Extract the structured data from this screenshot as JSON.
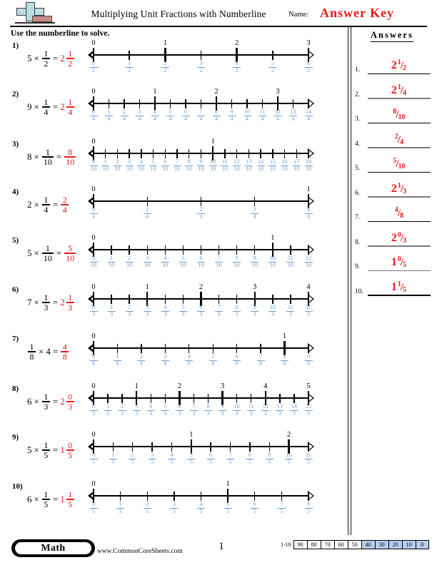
{
  "header": {
    "title": "Multiplying Unit Fractions with Numberline",
    "name_label": "Name:",
    "answer_key": "Answer Key",
    "logo_name": "commoncoresheets-logo"
  },
  "instructions": "Use the numberline to solve.",
  "answers_panel": {
    "heading": "Answers",
    "items": [
      {
        "num": "1.",
        "whole": "2",
        "numerator": "1",
        "denominator": "2",
        "rule_color": "#000000"
      },
      {
        "num": "2.",
        "whole": "2",
        "numerator": "1",
        "denominator": "4",
        "rule_color": "#7a7a7a"
      },
      {
        "num": "3.",
        "whole": "",
        "numerator": "8",
        "denominator": "10",
        "rule_color": "#000000"
      },
      {
        "num": "4.",
        "whole": "",
        "numerator": "2",
        "denominator": "4",
        "rule_color": "#7a7a7a"
      },
      {
        "num": "5.",
        "whole": "",
        "numerator": "5",
        "denominator": "10",
        "rule_color": "#000000"
      },
      {
        "num": "6.",
        "whole": "2",
        "numerator": "1",
        "denominator": "3",
        "rule_color": "#7a7a7a"
      },
      {
        "num": "7.",
        "whole": "",
        "numerator": "4",
        "denominator": "8",
        "rule_color": "#000000"
      },
      {
        "num": "8.",
        "whole": "2",
        "numerator": "0",
        "denominator": "3",
        "rule_color": "#7a7a7a"
      },
      {
        "num": "9.",
        "whole": "1",
        "numerator": "0",
        "denominator": "5",
        "rule_color": "#7a7a7a"
      },
      {
        "num": "10.",
        "whole": "1",
        "numerator": "1",
        "denominator": "5",
        "rule_color": "#000000"
      }
    ]
  },
  "problems": [
    {
      "num": "1)",
      "expr": {
        "a": "5",
        "op": "×",
        "frac_num": "1",
        "frac_den": "2",
        "eq": "=",
        "ans_whole": "2",
        "ans_num": "1",
        "ans_den": "2",
        "reversed": false
      },
      "numberline": {
        "denominator": 2,
        "max_numerator": 6,
        "wholes": [
          "0",
          "1",
          "2",
          "3"
        ]
      }
    },
    {
      "num": "2)",
      "expr": {
        "a": "9",
        "op": "×",
        "frac_num": "1",
        "frac_den": "4",
        "eq": "=",
        "ans_whole": "2",
        "ans_num": "1",
        "ans_den": "4",
        "reversed": false
      },
      "numberline": {
        "denominator": 4,
        "max_numerator": 14,
        "wholes": [
          "0",
          "1",
          "2",
          "3"
        ]
      }
    },
    {
      "num": "3)",
      "expr": {
        "a": "8",
        "op": "×",
        "frac_num": "1",
        "frac_den": "10",
        "eq": "=",
        "ans_whole": "",
        "ans_num": "8",
        "ans_den": "10",
        "reversed": false
      },
      "numberline": {
        "denominator": 10,
        "max_numerator": 18,
        "wholes": [
          "0",
          "1"
        ]
      }
    },
    {
      "num": "4)",
      "expr": {
        "a": "2",
        "op": "×",
        "frac_num": "1",
        "frac_den": "4",
        "eq": "=",
        "ans_whole": "",
        "ans_num": "2",
        "ans_den": "4",
        "reversed": false
      },
      "numberline": {
        "denominator": 4,
        "max_numerator": 4,
        "wholes": [
          "0",
          "1"
        ]
      }
    },
    {
      "num": "5)",
      "expr": {
        "a": "5",
        "op": "×",
        "frac_num": "1",
        "frac_den": "10",
        "eq": "=",
        "ans_whole": "",
        "ans_num": "5",
        "ans_den": "10",
        "reversed": false
      },
      "numberline": {
        "denominator": 10,
        "max_numerator": 12,
        "wholes": [
          "0",
          "1"
        ]
      }
    },
    {
      "num": "6)",
      "expr": {
        "a": "7",
        "op": "×",
        "frac_num": "1",
        "frac_den": "3",
        "eq": "=",
        "ans_whole": "2",
        "ans_num": "1",
        "ans_den": "3",
        "reversed": false
      },
      "numberline": {
        "denominator": 3,
        "max_numerator": 12,
        "wholes": [
          "0",
          "1",
          "2",
          "3",
          "4"
        ]
      }
    },
    {
      "num": "7)",
      "expr": {
        "a": "4",
        "op": "×",
        "frac_num": "1",
        "frac_den": "8",
        "eq": "=",
        "ans_whole": "",
        "ans_num": "4",
        "ans_den": "8",
        "reversed": true
      },
      "numberline": {
        "denominator": 8,
        "max_numerator": 9,
        "wholes": [
          "0",
          "1"
        ]
      }
    },
    {
      "num": "8)",
      "expr": {
        "a": "6",
        "op": "×",
        "frac_num": "1",
        "frac_den": "3",
        "eq": "=",
        "ans_whole": "2",
        "ans_num": "0",
        "ans_den": "3",
        "reversed": false
      },
      "numberline": {
        "denominator": 3,
        "max_numerator": 15,
        "wholes": [
          "0",
          "1",
          "2",
          "3",
          "4",
          "5"
        ]
      }
    },
    {
      "num": "9)",
      "expr": {
        "a": "5",
        "op": "×",
        "frac_num": "1",
        "frac_den": "5",
        "eq": "=",
        "ans_whole": "1",
        "ans_num": "0",
        "ans_den": "5",
        "reversed": false
      },
      "numberline": {
        "denominator": 5,
        "max_numerator": 11,
        "wholes": [
          "0",
          "1",
          "2"
        ]
      }
    },
    {
      "num": "10)",
      "expr": {
        "a": "6",
        "op": "×",
        "frac_num": "1",
        "frac_den": "5",
        "eq": "=",
        "ans_whole": "1",
        "ans_num": "1",
        "ans_den": "5",
        "reversed": false
      },
      "numberline": {
        "denominator": 5,
        "max_numerator": 8,
        "wholes": [
          "0",
          "1"
        ]
      }
    }
  ],
  "footer": {
    "subject": "Math",
    "url": "www.CommonCoreSheets.com",
    "page": "1",
    "score_range": "1-10",
    "score_cells": [
      {
        "label": "90",
        "highlighted": false
      },
      {
        "label": "80",
        "highlighted": false
      },
      {
        "label": "70",
        "highlighted": false
      },
      {
        "label": "60",
        "highlighted": false
      },
      {
        "label": "50",
        "highlighted": false
      },
      {
        "label": "40",
        "highlighted": true
      },
      {
        "label": "30",
        "highlighted": true
      },
      {
        "label": "20",
        "highlighted": true
      },
      {
        "label": "10",
        "highlighted": true
      },
      {
        "label": "0",
        "highlighted": true
      }
    ]
  },
  "colors": {
    "answer_red": "#e8191b",
    "fraction_blue": "#6d9ed6",
    "highlight_blue": "#b8cdee"
  }
}
